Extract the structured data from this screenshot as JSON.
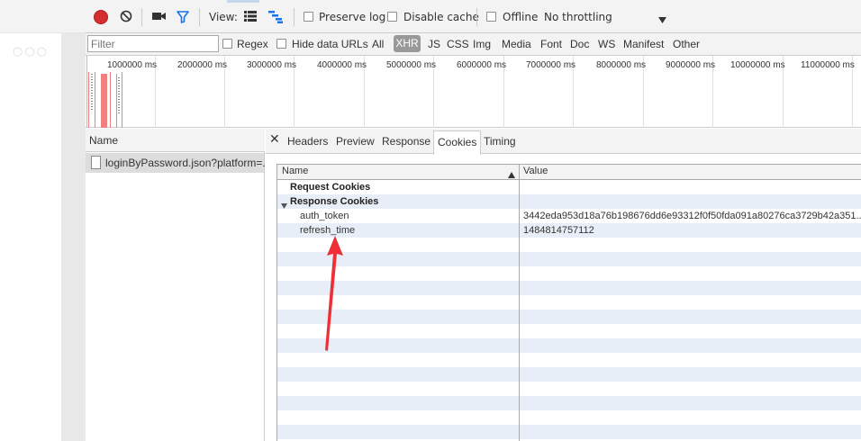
{
  "toolbar": {
    "view_label": "View:",
    "preserve_log": "Preserve log",
    "disable_cache": "Disable cache",
    "offline": "Offline",
    "throttling": "No throttling"
  },
  "filterbar": {
    "filter_placeholder": "Filter",
    "regex": "Regex",
    "hide_data_urls": "Hide data URLs",
    "types": [
      "All",
      "XHR",
      "JS",
      "CSS",
      "Img",
      "Media",
      "Font",
      "Doc",
      "WS",
      "Manifest",
      "Other"
    ],
    "active_type": "XHR"
  },
  "overview": {
    "tick_labels": [
      "1000000 ms",
      "2000000 ms",
      "3000000 ms",
      "4000000 ms",
      "5000000 ms",
      "6000000 ms",
      "7000000 ms",
      "8000000 ms",
      "9000000 ms",
      "10000000 ms",
      "11000000 ms"
    ]
  },
  "request_list": {
    "header": "Name",
    "rows": [
      {
        "name": "loginByPassword.json?platform=..."
      }
    ]
  },
  "detail": {
    "tabs": [
      "Headers",
      "Preview",
      "Response",
      "Cookies",
      "Timing"
    ],
    "active_tab": "Cookies",
    "cookies": {
      "col_name": "Name",
      "col_value": "Value",
      "request_section": "Request Cookies",
      "response_section": "Response Cookies",
      "rows": [
        {
          "name": "auth_token",
          "value": "3442eda953d18a76b198676dd6e93312f0f50fda091a80276ca3729b42a351..."
        },
        {
          "name": "refresh_time",
          "value": "1484814757112"
        }
      ]
    }
  },
  "annotation": {
    "color": "#ee2f35"
  },
  "colors": {
    "record": "#d32f2f",
    "filter_accent": "#1a73e8",
    "overview_bar": "#f08080"
  }
}
